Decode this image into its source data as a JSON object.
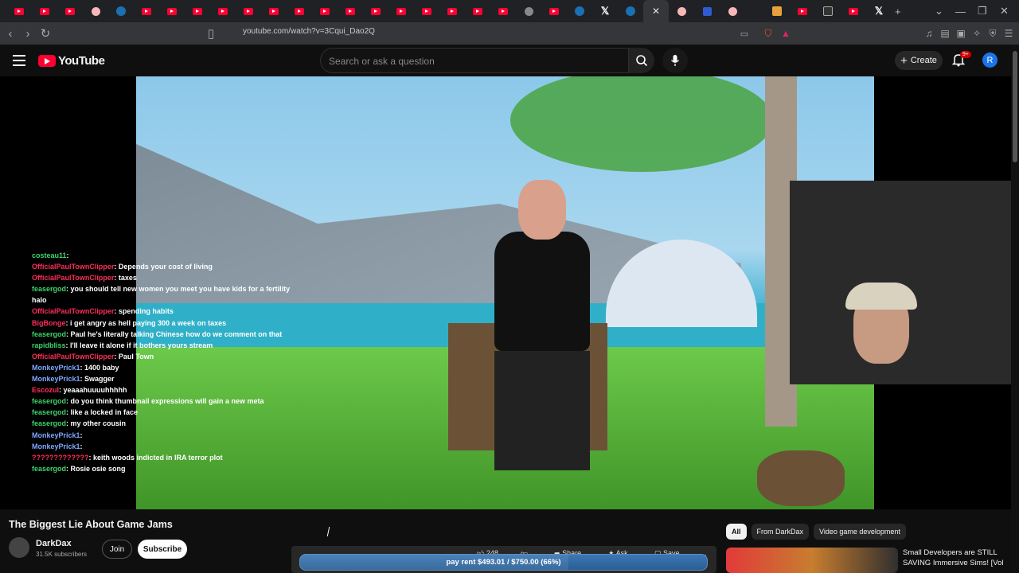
{
  "browser": {
    "url": "youtube.com/watch?v=3Cqui_Dao2Q"
  },
  "youtube": {
    "logo_text": "YouTube",
    "search_placeholder": "Search or ask a question",
    "create_label": "Create",
    "notification_count": "9+",
    "avatar_letter": "R"
  },
  "chat": [
    {
      "user": "costeau11",
      "color": "#3fd46a",
      "msg": ""
    },
    {
      "user": "OfficialPaulTownClipper",
      "color": "#ff2e5b",
      "msg": "Depends your cost of living"
    },
    {
      "user": "OfficialPaulTownClipper",
      "color": "#ff2e5b",
      "msg": "taxes"
    },
    {
      "user": "feasergod",
      "color": "#3fd46a",
      "msg": "you should tell new women you meet you have kids for a fertility"
    },
    {
      "user": "",
      "color": "#3fd46a",
      "msg": "halo"
    },
    {
      "user": "OfficialPaulTownClipper",
      "color": "#ff2e5b",
      "msg": "spending habits"
    },
    {
      "user": "BigBonge",
      "color": "#ff2e5b",
      "msg": "i get angry as hell paying 300 a week on taxes"
    },
    {
      "user": "feasergod",
      "color": "#3fd46a",
      "msg": "Paul he's literally talking Chinese how do we comment on that"
    },
    {
      "user": "rapidbliss",
      "color": "#3fd46a",
      "msg": "I'll leave it alone if it bothers yours stream"
    },
    {
      "user": "OfficialPaulTownClipper",
      "color": "#ff2e5b",
      "msg": "Paul Town"
    },
    {
      "user": "MonkeyPrick1",
      "color": "#7fa8ff",
      "msg": "1400 baby"
    },
    {
      "user": "MonkeyPrick1",
      "color": "#7fa8ff",
      "msg": "Swagger"
    },
    {
      "user": "Escozul",
      "color": "#ff2e5b",
      "msg": "yeaaahuuuuhhhhh"
    },
    {
      "user": "feasergod",
      "color": "#3fd46a",
      "msg": "do you think thumbnail expressions will gain a new meta"
    },
    {
      "user": "feasergod",
      "color": "#3fd46a",
      "msg": "like a locked in face"
    },
    {
      "user": "feasergod",
      "color": "#3fd46a",
      "msg": "my other cousin"
    },
    {
      "user": "MonkeyPrick1",
      "color": "#7fa8ff",
      "msg": ""
    },
    {
      "user": "MonkeyPrick1",
      "color": "#7fa8ff",
      "msg": ""
    },
    {
      "user": "?????????????",
      "color": "#ff2e5b",
      "msg": "keith woods indicted in IRA terror plot"
    },
    {
      "user": "feasergod",
      "color": "#3fd46a",
      "msg": "Rosie osie song"
    }
  ],
  "video": {
    "title": "The Biggest Lie About Game Jams",
    "channel": "DarkDax",
    "subscribers": "31.5K subscribers",
    "join_label": "Join",
    "subscribe_label": "Subscribe",
    "likes": "248",
    "share_label": "Share",
    "ask_label": "Ask",
    "save_label": "Save",
    "more_label": "..."
  },
  "rent_bar": {
    "text": "pay rent $493.01 / $750.00 (66%)",
    "progress": 0.66
  },
  "chips": [
    "All",
    "From DarkDax",
    "Video game development"
  ],
  "recommendation": {
    "title": "Small Developers are STILL SAVING Immersive Sims! [Vol"
  }
}
